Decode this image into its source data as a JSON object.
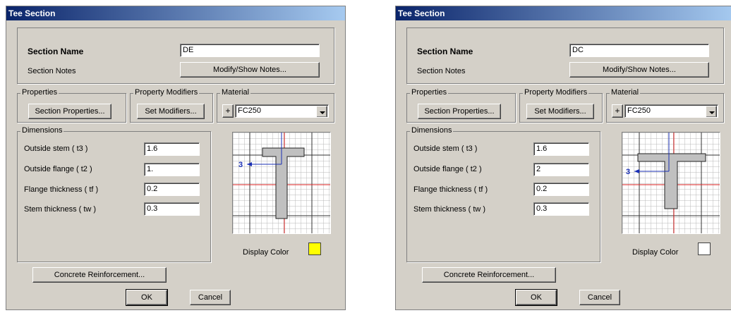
{
  "dialogs": [
    {
      "title": "Tee Section",
      "section_name_label": "Section Name",
      "section_name_value": "DE",
      "section_notes_label": "Section Notes",
      "modify_notes_button": "Modify/Show Notes...",
      "properties_group": "Properties",
      "section_properties_button": "Section Properties...",
      "modifiers_group": "Property Modifiers",
      "set_modifiers_button": "Set Modifiers...",
      "material_group": "Material",
      "material_plus": "+",
      "material_value": "FC250",
      "dimensions_group": "Dimensions",
      "dims": [
        {
          "label": "Outside stem  ( t3 )",
          "value": "1.6"
        },
        {
          "label": "Outside flange  ( t2 )",
          "value": "1."
        },
        {
          "label": "Flange thickness  ( tf )",
          "value": "0.2"
        },
        {
          "label": "Stem thickness  ( tw )",
          "value": "0.3"
        }
      ],
      "axis_label": "3",
      "display_color_label": "Display Color",
      "display_color": "#ffff00",
      "concrete_button": "Concrete Reinforcement...",
      "ok_button": "OK",
      "cancel_button": "Cancel"
    },
    {
      "title": "Tee Section",
      "section_name_label": "Section Name",
      "section_name_value": "DC",
      "section_notes_label": "Section Notes",
      "modify_notes_button": "Modify/Show Notes...",
      "properties_group": "Properties",
      "section_properties_button": "Section Properties...",
      "modifiers_group": "Property Modifiers",
      "set_modifiers_button": "Set Modifiers...",
      "material_group": "Material",
      "material_plus": "+",
      "material_value": "FC250",
      "dimensions_group": "Dimensions",
      "dims": [
        {
          "label": "Outside stem  ( t3 )",
          "value": "1.6"
        },
        {
          "label": "Outside flange  ( t2 )",
          "value": "2"
        },
        {
          "label": "Flange thickness  ( tf )",
          "value": "0.2"
        },
        {
          "label": "Stem thickness  ( tw )",
          "value": "0.3"
        }
      ],
      "axis_label": "3",
      "display_color_label": "Display Color",
      "display_color": "#ffffff",
      "concrete_button": "Concrete Reinforcement...",
      "ok_button": "OK",
      "cancel_button": "Cancel"
    }
  ]
}
